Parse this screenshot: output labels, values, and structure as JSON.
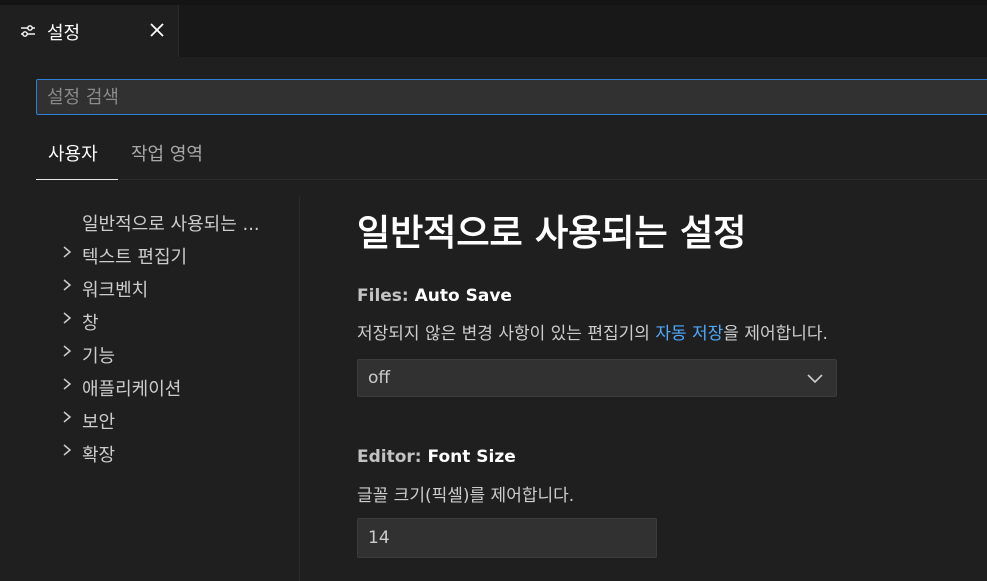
{
  "tab": {
    "title": "설정",
    "icon": "settings-sliders-icon",
    "close_icon": "close-icon"
  },
  "search": {
    "placeholder": "설정 검색",
    "value": ""
  },
  "scope_tabs": [
    {
      "label": "사용자",
      "active": true
    },
    {
      "label": "작업 영역",
      "active": false
    }
  ],
  "toc": {
    "items": [
      {
        "label": "일반적으로 사용되는 ...",
        "expandable": false
      },
      {
        "label": "텍스트 편집기",
        "expandable": true
      },
      {
        "label": "워크벤치",
        "expandable": true
      },
      {
        "label": "창",
        "expandable": true
      },
      {
        "label": "기능",
        "expandable": true
      },
      {
        "label": "애플리케이션",
        "expandable": true
      },
      {
        "label": "보안",
        "expandable": true
      },
      {
        "label": "확장",
        "expandable": true
      }
    ]
  },
  "content": {
    "section_title": "일반적으로 사용되는 설정",
    "settings": [
      {
        "category": "Files: ",
        "name": "Auto Save",
        "description_before": "저장되지 않은 변경 사항이 있는 편집기의 ",
        "description_link": "자동 저장",
        "description_after": "을 제어합니다.",
        "control": "select",
        "value": "off"
      },
      {
        "category": "Editor: ",
        "name": "Font Size",
        "description_before": "글꼴 크기(픽셀)를 제어합니다.",
        "control": "number",
        "value": "14"
      }
    ]
  },
  "colors": {
    "background": "#1f1f1f",
    "accent": "#2f7fd6",
    "link": "#4daafc"
  }
}
